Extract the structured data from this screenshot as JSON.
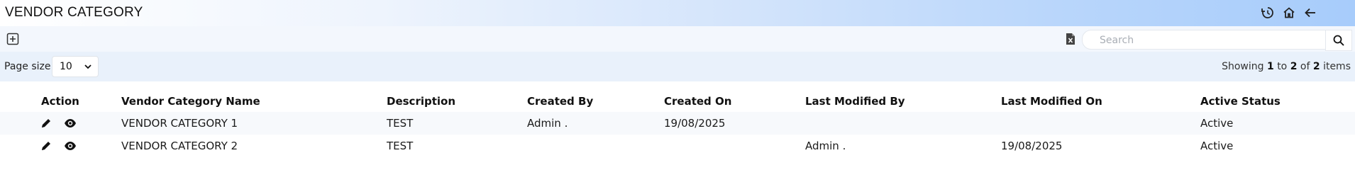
{
  "header": {
    "title": "VENDOR CATEGORY"
  },
  "toolbar": {
    "search_placeholder": "Search"
  },
  "pagination": {
    "page_size_label": "Page size:",
    "page_size_value": "10",
    "showing_prefix": "Showing",
    "from": "1",
    "to_word": "to",
    "to": "2",
    "of_word": "of",
    "total": "2",
    "items_word": "items"
  },
  "table": {
    "headers": [
      "Action",
      "Vendor Category Name",
      "Description",
      "Created By",
      "Created On",
      "Last Modified By",
      "Last Modified On",
      "Active Status"
    ],
    "rows": [
      {
        "name": "VENDOR CATEGORY 1",
        "description": "TEST",
        "created_by": "Admin .",
        "created_on": "19/08/2025",
        "modified_by": "",
        "modified_on": "",
        "status": "Active"
      },
      {
        "name": "VENDOR CATEGORY 2",
        "description": "TEST",
        "created_by": "",
        "created_on": "",
        "modified_by": "Admin .",
        "modified_on": "19/08/2025",
        "status": "Active"
      }
    ]
  },
  "icons": [
    "history-icon",
    "home-icon",
    "back-arrow-icon",
    "add-icon",
    "excel-export-icon",
    "search-icon",
    "chevron-down-icon",
    "edit-icon",
    "view-icon"
  ]
}
